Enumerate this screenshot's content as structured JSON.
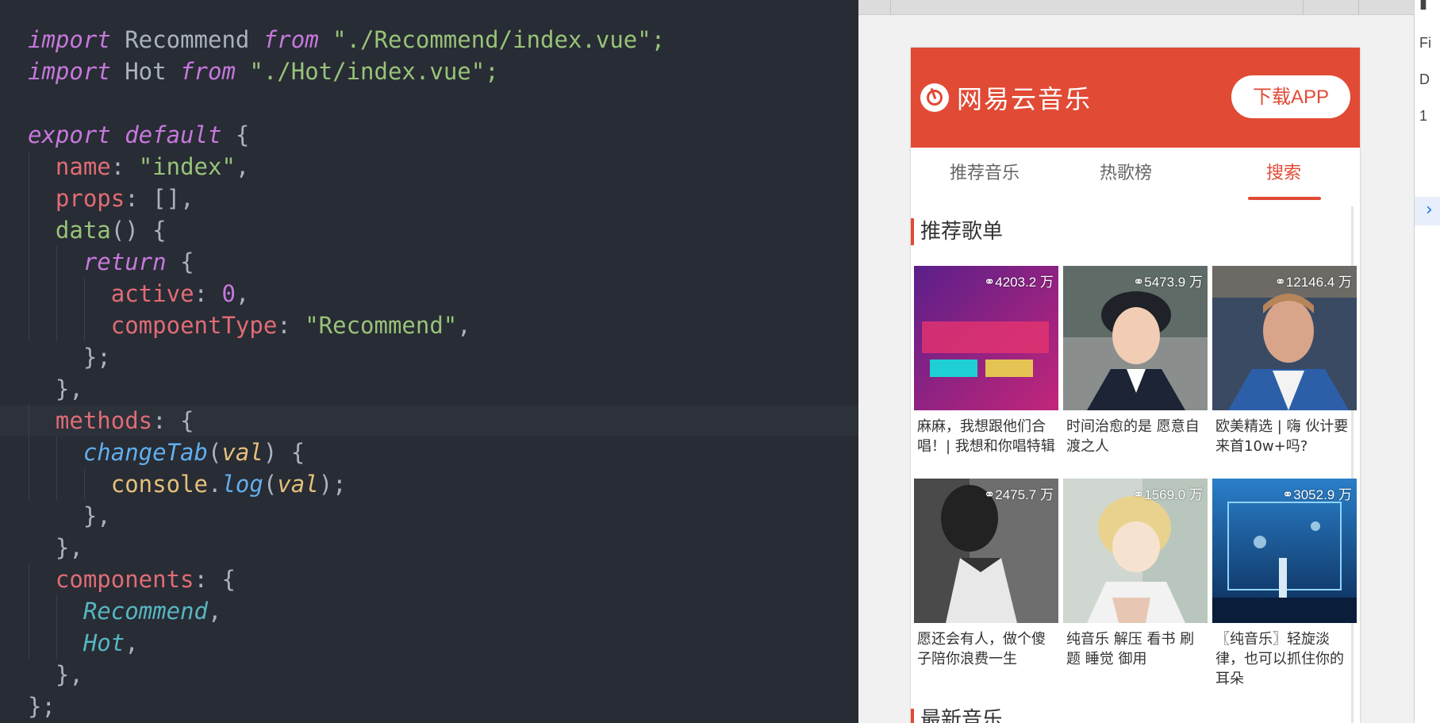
{
  "editor": {
    "lines": [
      [
        {
          "t": "import",
          "c": "kw"
        },
        {
          "t": " Recommend ",
          "c": "pun"
        },
        {
          "t": "from",
          "c": "kw"
        },
        {
          "t": " \"./Recommend/index.vue\";",
          "c": "str"
        }
      ],
      [
        {
          "t": "import",
          "c": "kw"
        },
        {
          "t": " Hot ",
          "c": "pun"
        },
        {
          "t": "from",
          "c": "kw"
        },
        {
          "t": " \"./Hot/index.vue\";",
          "c": "str"
        }
      ],
      [],
      [
        {
          "t": "export default",
          "c": "kw"
        },
        {
          "t": " {",
          "c": "pun"
        }
      ],
      [
        {
          "t": "  "
        },
        {
          "t": "name",
          "c": "prop"
        },
        {
          "t": ": ",
          "c": "pun"
        },
        {
          "t": "\"index\"",
          "c": "str"
        },
        {
          "t": ",",
          "c": "pun"
        }
      ],
      [
        {
          "t": "  "
        },
        {
          "t": "props",
          "c": "prop"
        },
        {
          "t": ": [],",
          "c": "pun"
        }
      ],
      [
        {
          "t": "  "
        },
        {
          "t": "data",
          "c": "fn"
        },
        {
          "t": "() {",
          "c": "pun"
        }
      ],
      [
        {
          "t": "    "
        },
        {
          "t": "return",
          "c": "kw"
        },
        {
          "t": " {",
          "c": "pun"
        }
      ],
      [
        {
          "t": "      "
        },
        {
          "t": "active",
          "c": "prop"
        },
        {
          "t": ": ",
          "c": "pun"
        },
        {
          "t": "0",
          "c": "num"
        },
        {
          "t": ",",
          "c": "pun"
        }
      ],
      [
        {
          "t": "      "
        },
        {
          "t": "compoentType",
          "c": "prop"
        },
        {
          "t": ": ",
          "c": "pun"
        },
        {
          "t": "\"Recommend\"",
          "c": "str"
        },
        {
          "t": ",",
          "c": "pun"
        }
      ],
      [
        {
          "t": "    };",
          "c": "pun"
        }
      ],
      [
        {
          "t": "  },",
          "c": "pun"
        }
      ],
      [
        {
          "t": "  "
        },
        {
          "t": "methods",
          "c": "prop"
        },
        {
          "t": ": {",
          "c": "pun"
        }
      ],
      [
        {
          "t": "    "
        },
        {
          "t": "changeTab",
          "c": "call"
        },
        {
          "t": "(",
          "c": "pun"
        },
        {
          "t": "val",
          "c": "par"
        },
        {
          "t": ") {",
          "c": "pun"
        }
      ],
      [
        {
          "t": "      "
        },
        {
          "t": "console",
          "c": "obj"
        },
        {
          "t": ".",
          "c": "pun"
        },
        {
          "t": "log",
          "c": "call"
        },
        {
          "t": "(",
          "c": "pun"
        },
        {
          "t": "val",
          "c": "par"
        },
        {
          "t": ");",
          "c": "pun"
        }
      ],
      [
        {
          "t": "    },",
          "c": "pun"
        }
      ],
      [
        {
          "t": "  },",
          "c": "pun"
        }
      ],
      [
        {
          "t": "  "
        },
        {
          "t": "components",
          "c": "prop"
        },
        {
          "t": ": {",
          "c": "pun"
        }
      ],
      [
        {
          "t": "    "
        },
        {
          "t": "Recommend",
          "c": "comp"
        },
        {
          "t": ",",
          "c": "pun"
        }
      ],
      [
        {
          "t": "    "
        },
        {
          "t": "Hot",
          "c": "comp"
        },
        {
          "t": ",",
          "c": "pun"
        }
      ],
      [
        {
          "t": "  },",
          "c": "pun"
        }
      ],
      [
        {
          "t": "};",
          "c": "pun"
        }
      ]
    ],
    "current_line": 12,
    "colors": {
      "background": "#282c34",
      "keyword": "#c678dd",
      "string": "#98c379",
      "property": "#e06c75",
      "function": "#61afef"
    }
  },
  "app": {
    "logo_text": "网易云音乐",
    "logo_icon": "netease-music-icon",
    "download_button": "下载APP",
    "brand_color": "#e14a34",
    "tabs": [
      {
        "label": "推荐音乐",
        "active": false
      },
      {
        "label": "热歌榜",
        "active": false
      },
      {
        "label": "搜索",
        "active": true
      }
    ],
    "section_title": "推荐歌单",
    "next_section_title": "最新音乐",
    "playlists": [
      {
        "plays": "4203.2 万",
        "title": "麻麻，我想跟他们合唱！| 我想和你唱特辑",
        "cover": "purple-show-poster"
      },
      {
        "plays": "5473.9 万",
        "title": "时间治愈的是 愿意自渡之人",
        "cover": "girl-portrait"
      },
      {
        "plays": "12146.4 万",
        "title": "欧美精选 | 嗨 伙计要来首10w+吗?",
        "cover": "man-portrait"
      },
      {
        "plays": "2475.7 万",
        "title": "愿还会有人，做个傻子陪你浪费一生",
        "cover": "grayscale-girl"
      },
      {
        "plays": "1569.0 万",
        "title": "纯音乐 解压 看书 刷题 睡觉 御用",
        "cover": "anime-boy"
      },
      {
        "plays": "3052.9 万",
        "title": "〖纯音乐〗轻旋淡律，也可以抓住你的耳朵",
        "cover": "aquarium-scene"
      }
    ]
  },
  "devtools": {
    "items": [
      "Fi",
      "D",
      "1"
    ],
    "expand_icon": "chevron-right-icon"
  }
}
